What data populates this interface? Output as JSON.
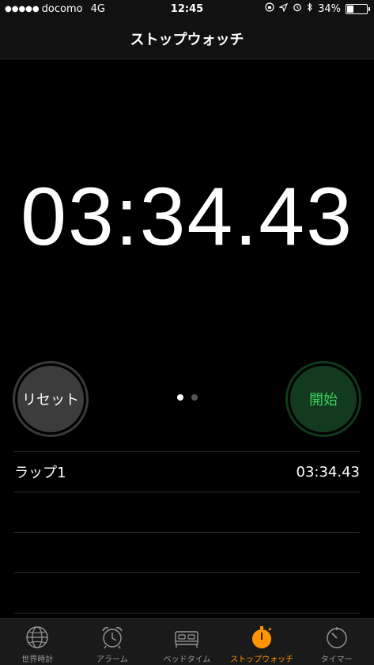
{
  "status": {
    "carrier": "docomo",
    "network": "4G",
    "time": "12:45",
    "battery_percent": "34%",
    "battery_level": 0.34
  },
  "nav": {
    "title": "ストップウォッチ"
  },
  "timer": {
    "value": "03:34.43"
  },
  "buttons": {
    "reset": "リセット",
    "start": "開始"
  },
  "laps": [
    {
      "label": "ラップ1",
      "time": "03:34.43"
    }
  ],
  "tabs": [
    {
      "label": "世界時計",
      "icon": "globe-icon"
    },
    {
      "label": "アラーム",
      "icon": "alarm-clock-icon"
    },
    {
      "label": "ベッドタイム",
      "icon": "bed-icon"
    },
    {
      "label": "ストップウォッチ",
      "icon": "stopwatch-icon"
    },
    {
      "label": "タイマー",
      "icon": "timer-icon"
    }
  ],
  "colors": {
    "accent": "#ff9500",
    "start_green": "#3fd15c",
    "background": "#000000"
  }
}
